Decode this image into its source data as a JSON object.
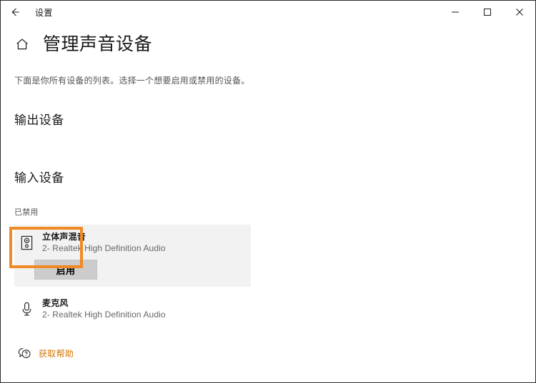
{
  "window": {
    "titlebar": {
      "back_icon": "back-arrow-icon",
      "title": "设置",
      "minimize_label": "─",
      "maximize_label": "□",
      "close_label": "✕"
    }
  },
  "header": {
    "home_icon": "home-icon",
    "title": "管理声音设备"
  },
  "main": {
    "description": "下面是你所有设备的列表。选择一个想要启用或禁用的设备。",
    "output_section": {
      "title": "输出设备"
    },
    "input_section": {
      "title": "输入设备",
      "group_label": "已禁用",
      "devices": [
        {
          "icon": "speaker-icon",
          "name": "立体声混音",
          "subtitle": "2- Realtek High Definition Audio",
          "action_label": "启用",
          "selected": true
        },
        {
          "icon": "microphone-icon",
          "name": "麦克风",
          "subtitle": "2- Realtek High Definition Audio",
          "selected": false
        }
      ]
    }
  },
  "footer": {
    "help_icon": "help-chat-icon",
    "help_text": "获取帮助"
  },
  "colors": {
    "accent_annotation": "#f08a24",
    "link": "#d77600",
    "selected_row_bg": "#f2f2f2",
    "button_bg": "#cccccc"
  }
}
